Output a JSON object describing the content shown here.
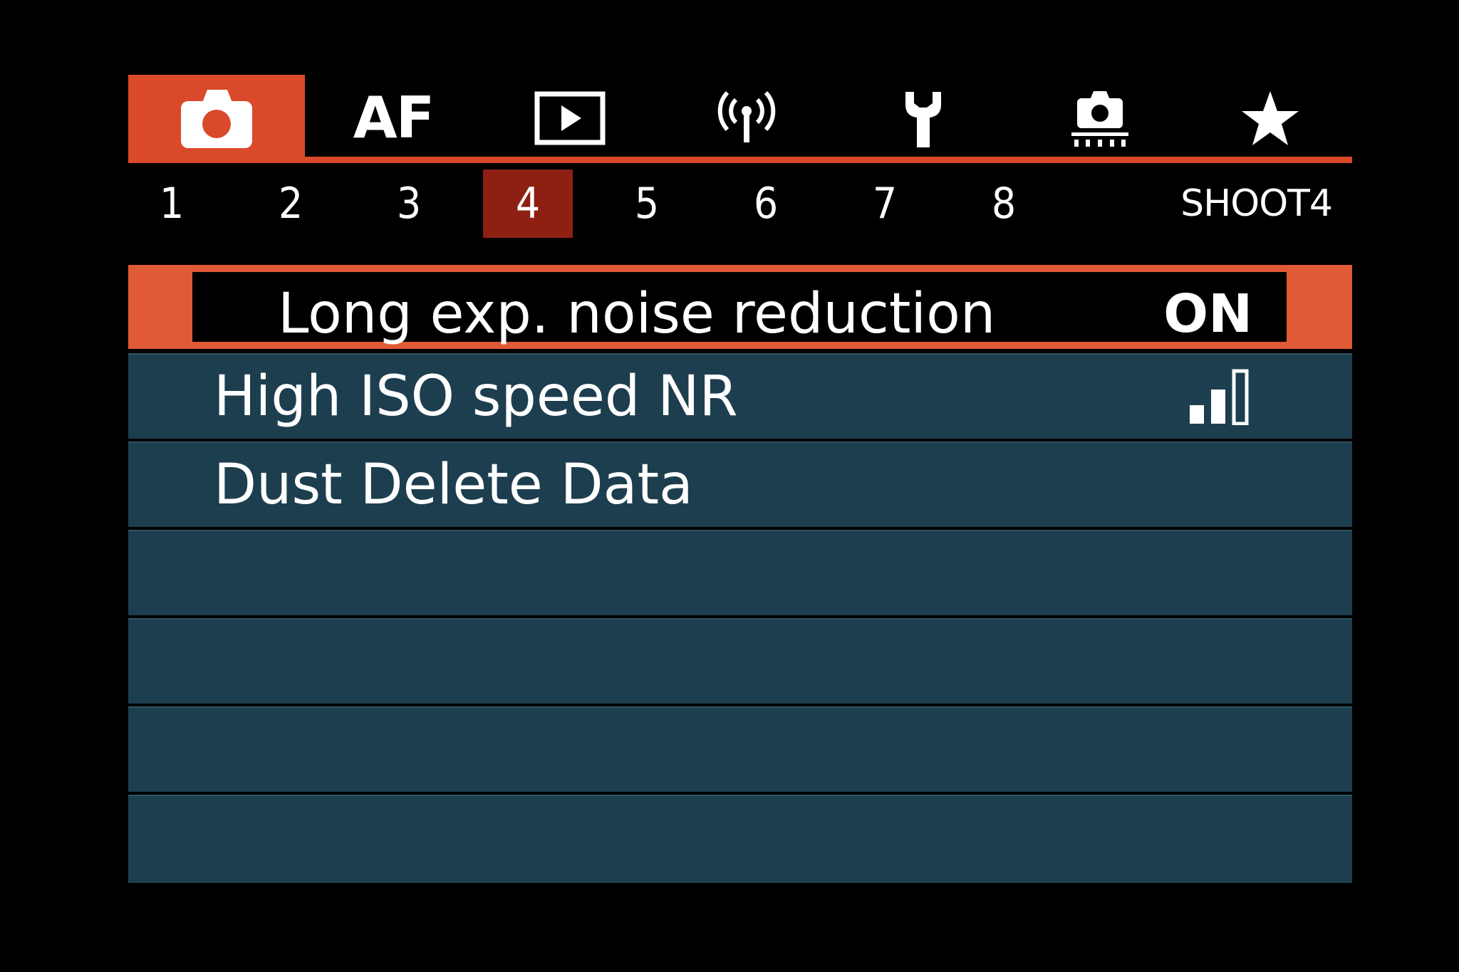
{
  "colors": {
    "accent": "#d9492a",
    "active_page": "#8e2013",
    "row_background": "#1d3e4e",
    "selected_row_frame": "#e05a35",
    "background": "#000000"
  },
  "category_tabs": [
    {
      "icon": "camera-icon",
      "active": true
    },
    {
      "label": "AF"
    },
    {
      "icon": "playback-icon"
    },
    {
      "icon": "wireless-icon"
    },
    {
      "icon": "wrench-icon"
    },
    {
      "icon": "custom-functions-icon"
    },
    {
      "icon": "star-icon"
    }
  ],
  "pages": [
    "1",
    "2",
    "3",
    "4",
    "5",
    "6",
    "7",
    "8"
  ],
  "active_page": "4",
  "page_title": "SHOOT4",
  "menu": {
    "items": [
      {
        "label": "Long exp. noise reduction",
        "value": "ON",
        "selected": true
      },
      {
        "label": "High ISO speed NR",
        "value_icon": "nr-level-icon",
        "nr_level": 2,
        "nr_max": 3
      },
      {
        "label": "Dust Delete Data"
      },
      {
        "label": ""
      },
      {
        "label": ""
      },
      {
        "label": ""
      },
      {
        "label": ""
      }
    ]
  }
}
